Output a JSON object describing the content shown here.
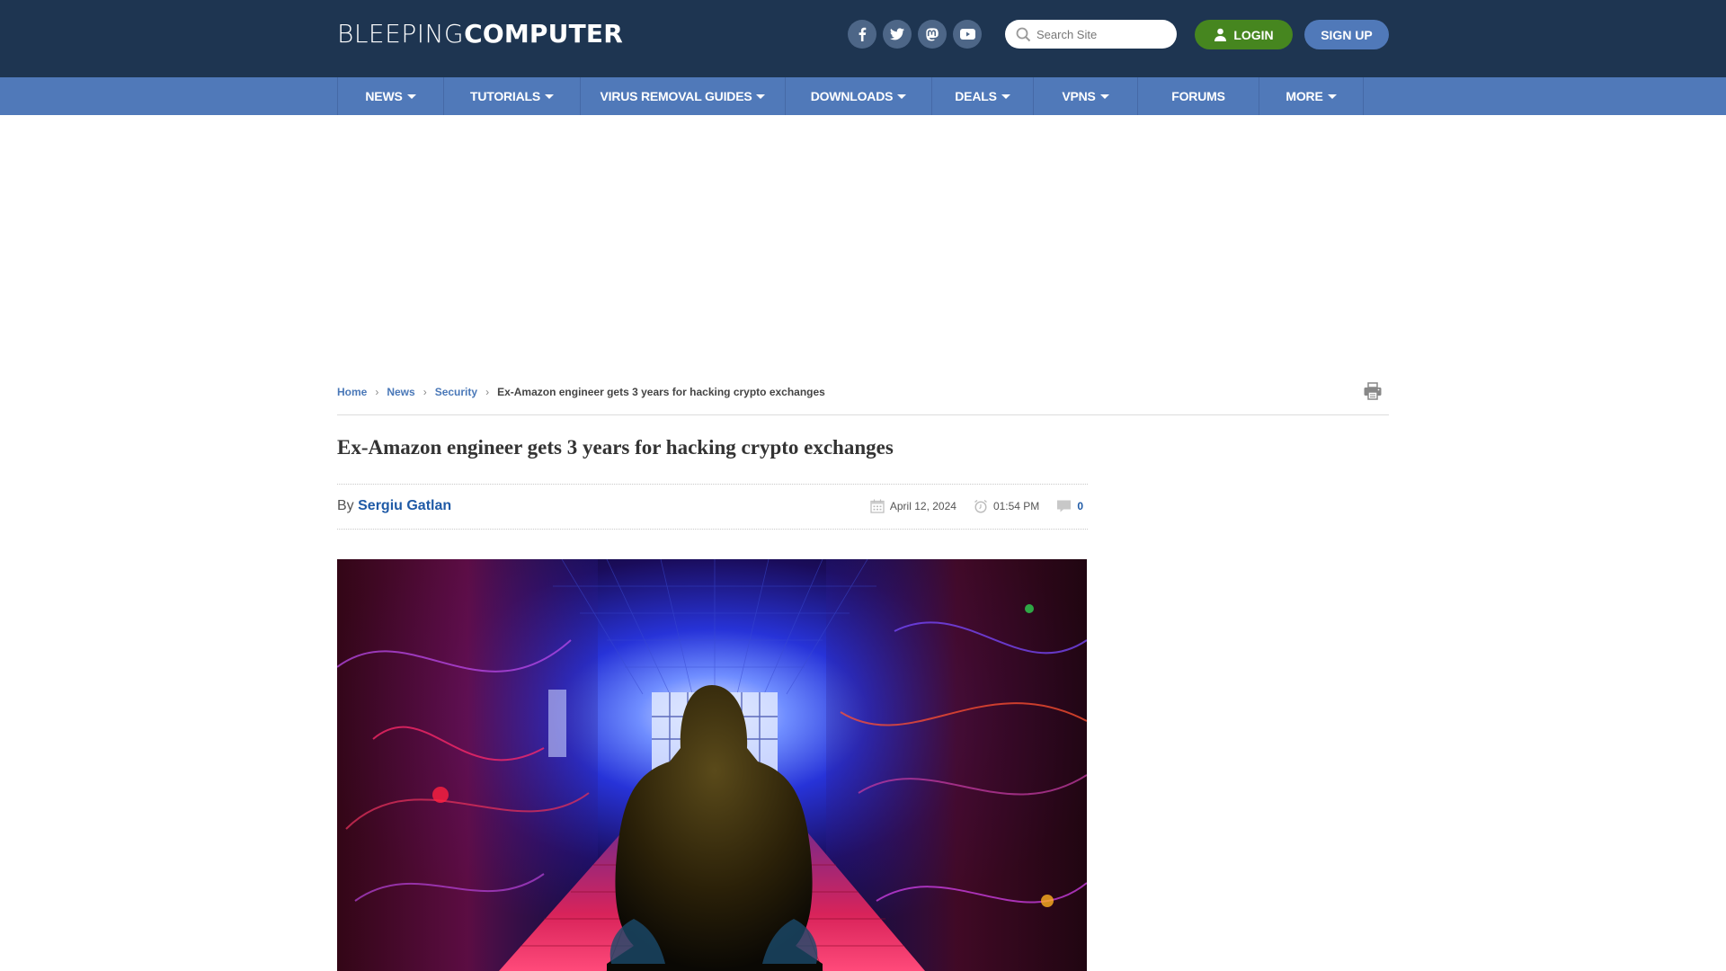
{
  "header": {
    "logo": {
      "light": "BLEEPING",
      "bold": "COMPUTER"
    },
    "social": [
      {
        "name": "facebook",
        "icon": "facebook-icon"
      },
      {
        "name": "twitter",
        "icon": "twitter-icon"
      },
      {
        "name": "mastodon",
        "icon": "mastodon-icon"
      },
      {
        "name": "youtube",
        "icon": "youtube-icon"
      }
    ],
    "search": {
      "placeholder": "Search Site",
      "value": ""
    },
    "login_label": "LOGIN",
    "signup_label": "SIGN UP"
  },
  "nav": {
    "items": [
      {
        "label": "NEWS",
        "dropdown": true
      },
      {
        "label": "TUTORIALS",
        "dropdown": true
      },
      {
        "label": "VIRUS REMOVAL GUIDES",
        "dropdown": true
      },
      {
        "label": "DOWNLOADS",
        "dropdown": true
      },
      {
        "label": "DEALS",
        "dropdown": true
      },
      {
        "label": "VPNS",
        "dropdown": true
      },
      {
        "label": "FORUMS",
        "dropdown": false
      },
      {
        "label": "MORE",
        "dropdown": true
      }
    ]
  },
  "breadcrumb": {
    "items": [
      "Home",
      "News",
      "Security"
    ],
    "current": "Ex-Amazon engineer gets 3 years for hacking crypto exchanges"
  },
  "article": {
    "title": "Ex-Amazon engineer gets 3 years for hacking crypto exchanges",
    "by_label": "By",
    "author": "Sergiu Gatlan",
    "date": "April 12, 2024",
    "time": "01:54 PM",
    "comments": "0",
    "hero_alt": "Hooded hacker sitting in a neon-lit digital corridor"
  },
  "colors": {
    "header_bg": "#1e3551",
    "nav_bg": "#5079b9",
    "login_bg": "#46861f",
    "signup_bg": "#5079b9",
    "link": "#1f5aa6"
  }
}
